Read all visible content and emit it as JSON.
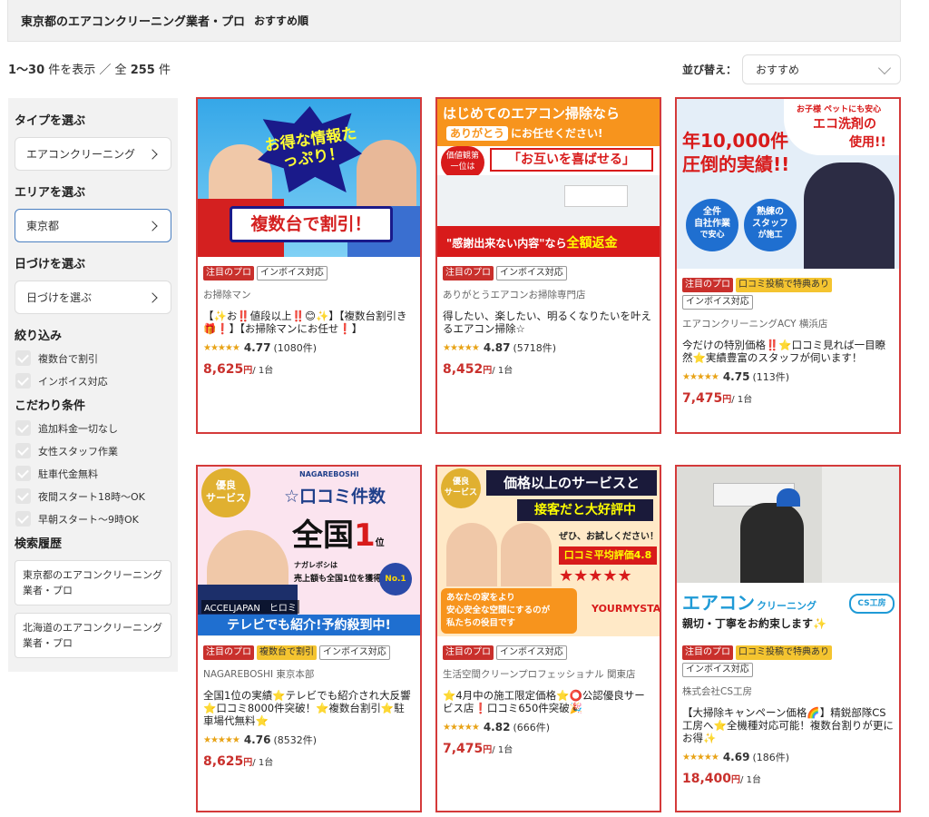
{
  "header": {
    "title": "東京都のエアコンクリーニング業者・プロ",
    "sort_note": "おすすめ順"
  },
  "results": {
    "range": "1〜30",
    "shown_label": "件を表示 ／ 全",
    "total": "255",
    "total_suffix": "件"
  },
  "sort": {
    "label": "並び替え：",
    "value": "おすすめ"
  },
  "sidebar": {
    "type_heading": "タイプを選ぶ",
    "type_value": "エアコンクリーニング",
    "area_heading": "エリアを選ぶ",
    "area_value": "東京都",
    "date_heading": "日づけを選ぶ",
    "date_value": "日づけを選ぶ",
    "filter_heading": "絞り込み",
    "filters": [
      "複数台で割引",
      "インボイス対応"
    ],
    "pref_heading": "こだわり条件",
    "prefs": [
      "追加料金一切なし",
      "女性スタッフ作業",
      "駐車代金無料",
      "夜間スタート18時〜OK",
      "早朝スタート〜9時OK"
    ],
    "history_heading": "検索履歴",
    "history": [
      "東京都のエアコンクリーニング業者・プロ",
      "北海道のエアコンクリーニング業者・プロ"
    ]
  },
  "cards": [
    {
      "banner": {
        "burst": "お得な情報たっぷり！",
        "bottom": "複数台で割引！"
      },
      "tags": [
        "注目のプロ",
        "インボイス対応"
      ],
      "shop": "お掃除マン",
      "desc": "【✨お‼️値段以上‼️😊✨】【複数台割引き🎁❗】【お掃除マンにお任せ❗】",
      "rating": "4.77",
      "reviews": "(1080件)",
      "price": "8,625",
      "yen": "円",
      "unit": "/ 1台"
    },
    {
      "banner": {
        "line1": "はじめてのエアコン掃除なら",
        "line2a": "ありがとう",
        "line2b": "にお任せください!",
        "badge": "価値観第一位は",
        "mid": "「お互いを喜ばせる」",
        "bottom_a": "\"感謝出来ない内容\"なら",
        "bottom_b": "全額返金"
      },
      "tags": [
        "注目のプロ",
        "インボイス対応"
      ],
      "shop": "ありがとうエアコンお掃除専門店",
      "desc": "得したい、楽したい、明るくなりたいを叶えるエアコン掃除☆",
      "rating": "4.87",
      "reviews": "(5718件)",
      "price": "8,452",
      "yen": "円",
      "unit": "/ 1台"
    },
    {
      "banner": {
        "corner_a": "お子様 ペットにも安心",
        "corner_b": "エコ洗剤の",
        "corner_c": "使用!!",
        "big_a": "年10,000件",
        "big_b": "圧倒的実績!!",
        "circle1_a": "全件",
        "circle1_b": "自社作業",
        "circle1_c": "で安心",
        "circle2_a": "熟練の",
        "circle2_b": "スタッフ",
        "circle2_c": "が施工"
      },
      "tags": [
        "注目のプロ",
        "口コミ投稿で特典あり",
        "インボイス対応"
      ],
      "shop": "エアコンクリーニングACY 横浜店",
      "desc": "今だけの特別価格‼️⭐口コミ見れば一目瞭然⭐実績豊富のスタッフが伺います！",
      "rating": "4.75",
      "reviews": "(113件)",
      "price": "7,475",
      "yen": "円",
      "unit": "/ 1台"
    },
    {
      "banner": {
        "badge_a": "優良",
        "badge_b": "サービス",
        "brand": "NAGAREBOSHI",
        "top": "☆口コミ件数",
        "big_a": "全国",
        "big_b": "1",
        "big_c": "位",
        "sub_a": "ナガレボシは",
        "sub_b": "売上額も全国1位を獲得",
        "no1": "No.1",
        "names": "ACCELJAPAN　ヒロミ",
        "bottom": "テレビでも紹介!予約殺到中!"
      },
      "tags": [
        "注目のプロ",
        "複数台で割引",
        "インボイス対応"
      ],
      "shop": "NAGAREBOSHI 東京本部",
      "desc": "全国1位の実績⭐テレビでも紹介され大反響⭐口コミ8000件突破！⭐複数台割引⭐駐車場代無料⭐",
      "rating": "4.76",
      "reviews": "(8532件)",
      "price": "8,625",
      "yen": "円",
      "unit": "/ 1台"
    },
    {
      "banner": {
        "badge_a": "優良",
        "badge_b": "サービス",
        "top_a": "価格以上のサービスと",
        "top_b": "接客だと大好評中",
        "try": "ぜひ、お試しください！",
        "avg": "口コミ平均評価4.8",
        "stars": "★★★★★",
        "msg_a": "あなたの家をより",
        "msg_b": "安心安全な空間にするのが",
        "msg_c": "私たちの役目です",
        "brand": "YOURMYSTAR"
      },
      "tags": [
        "注目のプロ",
        "インボイス対応"
      ],
      "shop": "生活空間クリーンプロフェッショナル 関東店",
      "desc": "⭐4月中の施工限定価格⭐⭕公認優良サービス店❗口コミ650件突破🎉",
      "rating": "4.82",
      "reviews": "(666件)",
      "price": "7,475",
      "yen": "円",
      "unit": "/ 1台"
    },
    {
      "banner": {
        "big": "エアコン",
        "small": "クリーニング",
        "logo": "CS工房",
        "sub": "親切・丁寧をお約束します✨"
      },
      "tags": [
        "注目のプロ",
        "口コミ投稿で特典あり",
        "インボイス対応"
      ],
      "shop": "株式会社CS工房",
      "desc": "【大掃除キャンペーン価格🌈】精鋭部隊CS工房へ⭐全機種対応可能！複数台割りが更にお得✨",
      "rating": "4.69",
      "reviews": "(186件)",
      "price": "18,400",
      "yen": "円",
      "unit": "/ 1台"
    }
  ],
  "colors": {
    "accent_red": "#c9302c",
    "card_border": "#d43a3a",
    "tag_yellow": "#f4c430",
    "star": "#e8a317"
  }
}
